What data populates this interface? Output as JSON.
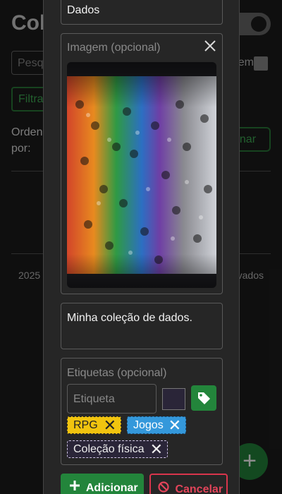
{
  "background": {
    "title_partial": "Col",
    "search_placeholder_partial": "Pesq",
    "sem_partial": "em",
    "filter_partial": "Filtra",
    "order_label": "Orden\npor:",
    "order_button_partial": "enar",
    "footer_left": "2025",
    "footer_right": "vados",
    "fab_icon": "plus-icon"
  },
  "modal": {
    "name_value": "Dados",
    "image": {
      "label": "Imagem (opcional)",
      "close_icon": "close-icon",
      "photo_description": "photo-dice-collection"
    },
    "description_value": "Minha coleção de dados.",
    "tags": {
      "label": "Etiquetas (opcional)",
      "input_placeholder": "Etiqueta",
      "color_value": "#2a2538",
      "add_tag_icon": "tag-icon",
      "chips": [
        {
          "label": "RPG",
          "color": "#f1c40f"
        },
        {
          "label": "Jogos",
          "color": "#3498db"
        },
        {
          "label": "Coleção física",
          "color": "#2a2538"
        }
      ]
    },
    "buttons": {
      "add_label": "Adicionar",
      "cancel_label": "Cancelar"
    }
  },
  "colors": {
    "primary_green": "#23853b",
    "danger_red": "#d9354c"
  }
}
